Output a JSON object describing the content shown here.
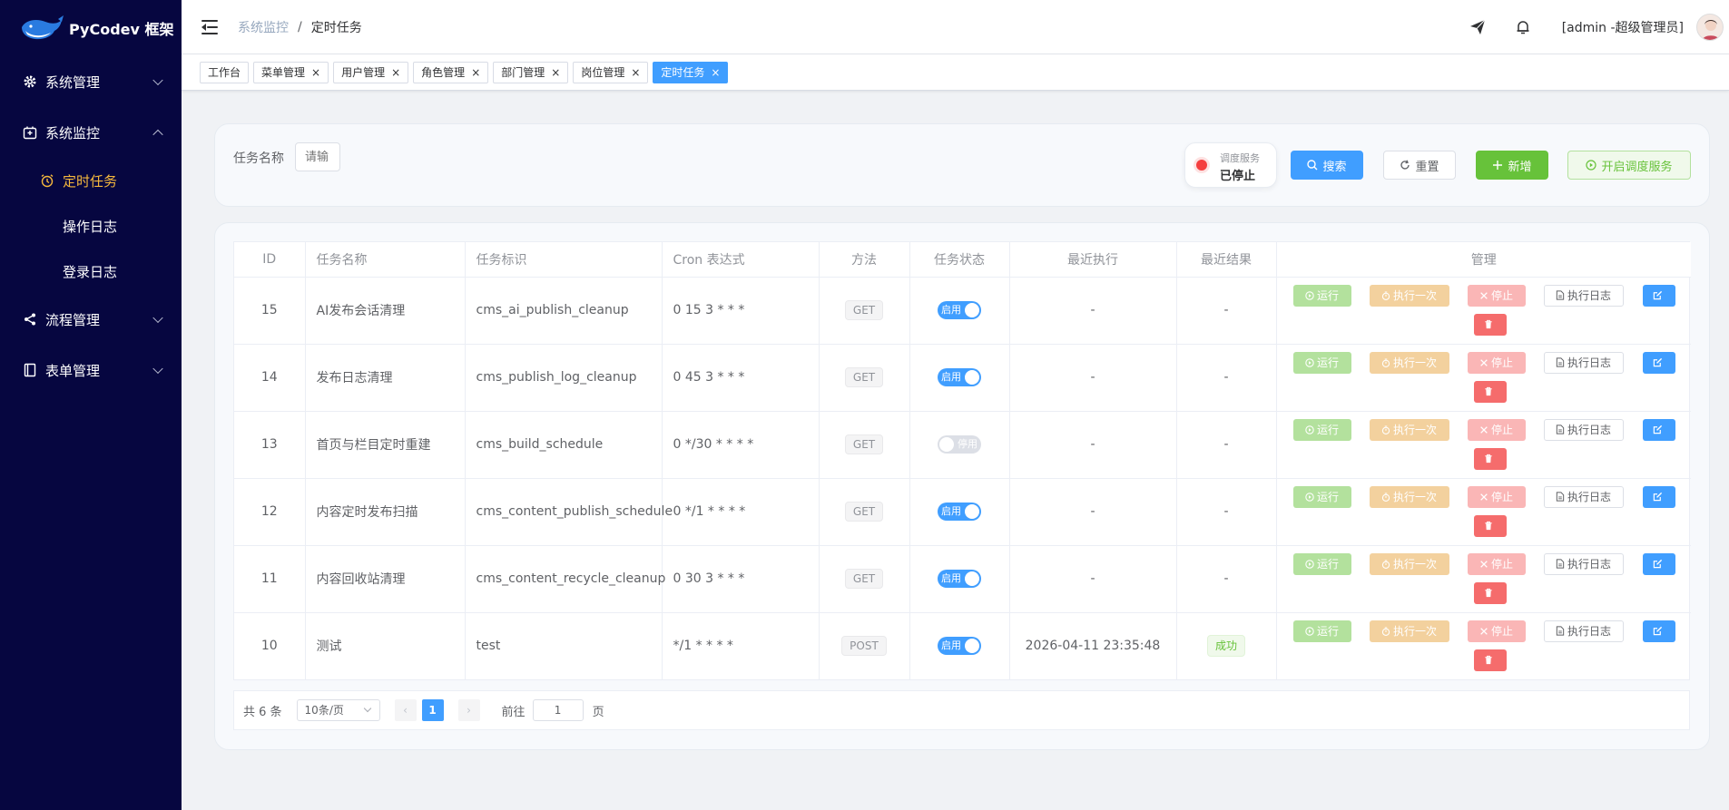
{
  "app": {
    "name": "PyCodev 框架"
  },
  "sidebar": {
    "menus": [
      {
        "label": "系统管理",
        "icon": "gear-icon",
        "expanded": false
      },
      {
        "label": "系统监控",
        "icon": "monitor-icon",
        "expanded": true
      },
      {
        "label": "流程管理",
        "icon": "share-icon",
        "expanded": false
      },
      {
        "label": "表单管理",
        "icon": "form-icon",
        "expanded": false
      }
    ],
    "submenus": [
      {
        "label": "定时任务",
        "active": true,
        "icon": "alarm-clock-icon"
      },
      {
        "label": "操作日志",
        "active": false
      },
      {
        "label": "登录日志",
        "active": false
      }
    ]
  },
  "header": {
    "breadcrumb": {
      "parent": "系统监控",
      "separator": "/",
      "current": "定时任务"
    },
    "user": "[admin -超级管理员]"
  },
  "tags": [
    {
      "label": "工作台",
      "closable": false,
      "active": false
    },
    {
      "label": "菜单管理",
      "closable": true,
      "active": false
    },
    {
      "label": "用户管理",
      "closable": true,
      "active": false
    },
    {
      "label": "角色管理",
      "closable": true,
      "active": false
    },
    {
      "label": "部门管理",
      "closable": true,
      "active": false
    },
    {
      "label": "岗位管理",
      "closable": true,
      "active": false
    },
    {
      "label": "定时任务",
      "closable": true,
      "active": true
    }
  ],
  "tag_close": "×",
  "search": {
    "label": "任务名称",
    "placeholder": "请输",
    "scheduler": {
      "title": "调度服务",
      "status": "已停止",
      "status_color": "#f53f3f"
    },
    "buttons": {
      "search": "搜索",
      "reset": "重置",
      "add": "新增",
      "start": "开启调度服务"
    }
  },
  "table": {
    "columns": [
      "ID",
      "任务名称",
      "任务标识",
      "Cron 表达式",
      "方法",
      "任务状态",
      "最近执行",
      "最近结果",
      "管理"
    ],
    "switch_labels": {
      "on": "启用",
      "off": "停用"
    },
    "actions": {
      "run": "运行",
      "once": "执行一次",
      "stop": "停止",
      "log": "执行日志"
    },
    "rows": [
      {
        "id": "15",
        "name": "AI发布会话清理",
        "key": "cms_ai_publish_cleanup",
        "cron": "0 15 3 * * *",
        "method": "GET",
        "enabled": true,
        "last_run": "-",
        "last_result": "-"
      },
      {
        "id": "14",
        "name": "发布日志清理",
        "key": "cms_publish_log_cleanup",
        "cron": "0 45 3 * * *",
        "method": "GET",
        "enabled": true,
        "last_run": "-",
        "last_result": "-"
      },
      {
        "id": "13",
        "name": "首页与栏目定时重建",
        "key": "cms_build_schedule",
        "cron": "0 */30 * * * *",
        "method": "GET",
        "enabled": false,
        "last_run": "-",
        "last_result": "-"
      },
      {
        "id": "12",
        "name": "内容定时发布扫描",
        "key": "cms_content_publish_schedule",
        "cron": "0 */1 * * * *",
        "method": "GET",
        "enabled": true,
        "last_run": "-",
        "last_result": "-"
      },
      {
        "id": "11",
        "name": "内容回收站清理",
        "key": "cms_content_recycle_cleanup",
        "cron": "0 30 3 * * *",
        "method": "GET",
        "enabled": true,
        "last_run": "-",
        "last_result": "-"
      },
      {
        "id": "10",
        "name": "测试",
        "key": "test",
        "cron": "*/1 * * * *",
        "method": "POST",
        "enabled": true,
        "last_run": "2026-04-11 23:35:48",
        "last_result": "成功"
      }
    ]
  },
  "pagination": {
    "total": "共 6 条",
    "page_size": "10条/页",
    "prev": "‹",
    "next": "›",
    "current": "1",
    "goto": "前往",
    "goto_value": "1",
    "page_suffix": "页"
  },
  "colors": {
    "sidebar_bg": "#060640",
    "primary": "#409eff",
    "success": "#67c23a",
    "warning": "#e6a23c",
    "danger": "#f56c6c",
    "active_menu": "#f5b83d"
  }
}
